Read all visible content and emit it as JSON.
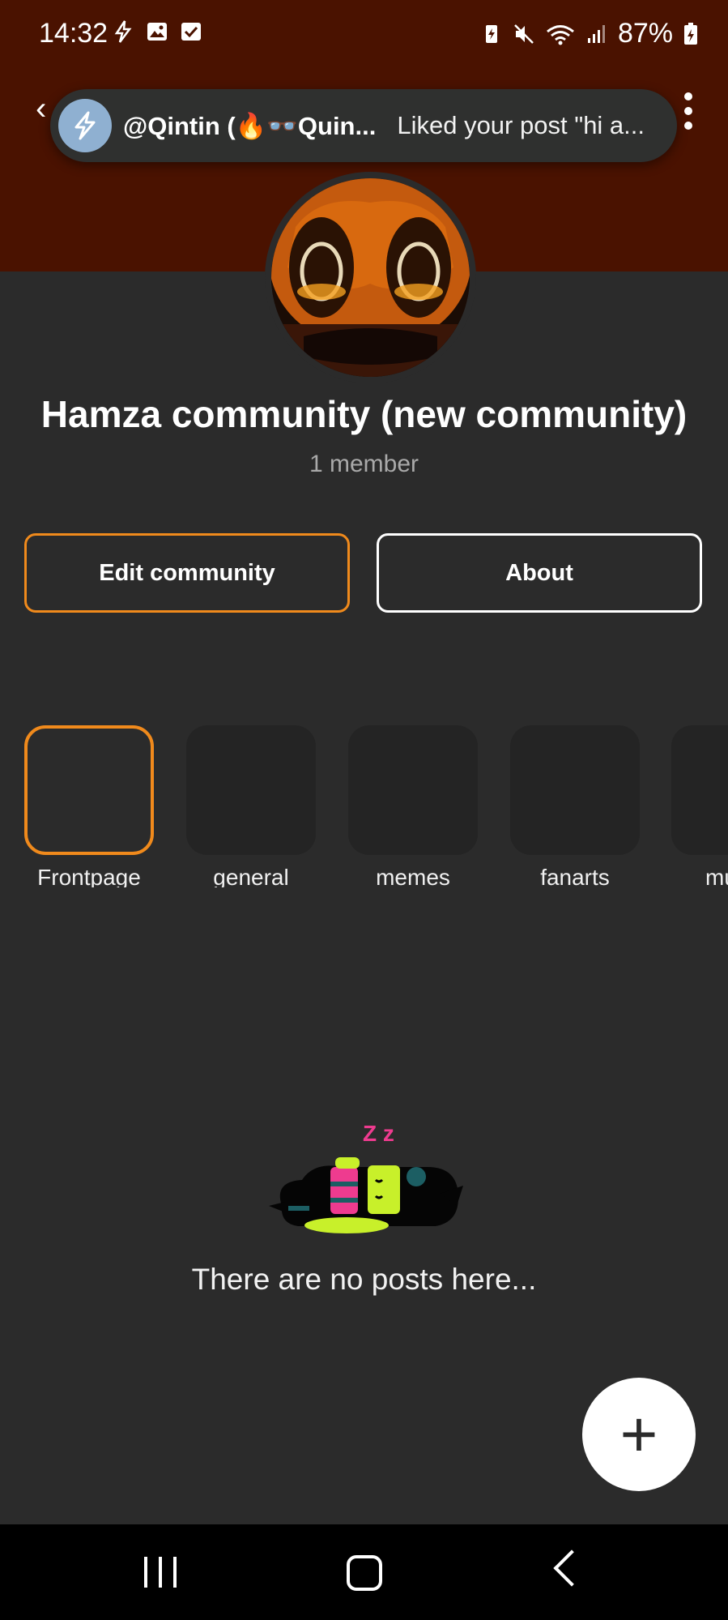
{
  "status_bar": {
    "time": "14:32",
    "battery": "87%",
    "icons_left": [
      "bolt-app-icon",
      "image-icon",
      "checkbox-icon"
    ],
    "icons_right": [
      "battery-saver-icon",
      "mute-icon",
      "wifi-icon",
      "signal-icon",
      "battery-charging-icon"
    ]
  },
  "notification": {
    "user": "@Qintin (🔥👓Quin...",
    "message": "Liked your post \"hi a..."
  },
  "community": {
    "name": "Hamza community (new community)",
    "members": "1 member"
  },
  "actions": {
    "edit_label": "Edit community",
    "about_label": "About"
  },
  "channels": [
    {
      "label": "Frontpage",
      "active": true
    },
    {
      "label": "general",
      "active": false
    },
    {
      "label": "memes",
      "active": false
    },
    {
      "label": "fanarts",
      "active": false
    },
    {
      "label": "mu",
      "active": false
    }
  ],
  "empty_state": {
    "text": "There are no posts here...",
    "sleep_text": "Z z"
  },
  "fab": {
    "label": "+"
  },
  "colors": {
    "banner": "#4a1200",
    "background": "#2b2b2b",
    "accent": "#f08a1c",
    "tile": "#242424"
  }
}
